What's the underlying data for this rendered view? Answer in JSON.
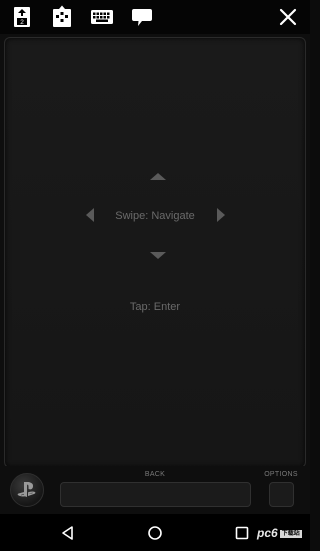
{
  "toolbar": {
    "second_screen_badge": "2",
    "icons": [
      "second-screen-icon",
      "gamepad-icon",
      "keyboard-icon",
      "chat-icon",
      "close-icon"
    ]
  },
  "touchpad": {
    "swipe_hint": "Swipe: Navigate",
    "tap_hint": "Tap: Enter"
  },
  "controls": {
    "back_label": "BACK",
    "options_label": "OPTIONS"
  },
  "navbar": {
    "watermark": "pc6",
    "watermark_badge": "下载站"
  },
  "colors": {
    "background": "#0e0e0e",
    "toolbar": "#050505",
    "hint_text": "#6a6a6a",
    "icon": "#ffffff"
  }
}
